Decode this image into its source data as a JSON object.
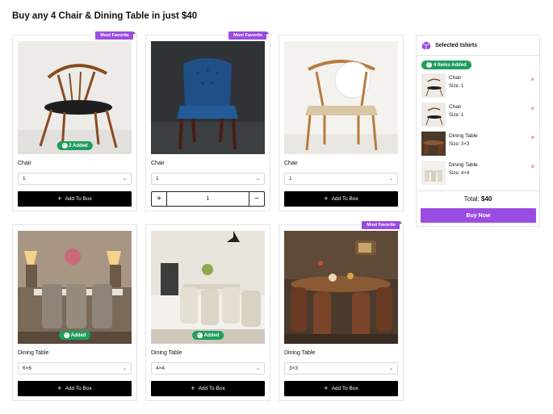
{
  "page": {
    "title": "Buy any 4 Chair & Dining Table in just $40"
  },
  "products": [
    {
      "ribbon": "Most Favorite",
      "badge": "2 Added",
      "name": "Chair",
      "option": "1",
      "button": "Add To Box"
    },
    {
      "ribbon": "Most Favorite",
      "name": "Chair",
      "option": "1",
      "quantity": "1"
    },
    {
      "name": "Chair",
      "option": "1",
      "button": "Add To Box"
    },
    {
      "badge": "Added",
      "name": "Dining Table",
      "option": "6×6",
      "button": "Add To Box"
    },
    {
      "badge": "Added",
      "name": "Dining Table",
      "option": "4×4",
      "button": "Add To Box"
    },
    {
      "ribbon": "Most Favorite",
      "name": "Dining Table",
      "option": "3×3",
      "button": "Add To Box"
    }
  ],
  "cart": {
    "title": "Selected tshirts",
    "badge": "4 Items Added",
    "items": [
      {
        "name": "Chair",
        "size": "Size: 1"
      },
      {
        "name": "Chair",
        "size": "Size: 1"
      },
      {
        "name": "Dining Table",
        "size": "Size: 3×3"
      },
      {
        "name": "Dining Table",
        "size": "Size: 4×4"
      }
    ],
    "total_label": "Total:",
    "total_value": "$40",
    "buy_label": "Buy Now"
  },
  "icons": {
    "remove": "×",
    "plus": "+",
    "minus": "−",
    "chevron": "⌄",
    "check": "✓"
  },
  "colors": {
    "accent": "#9b4ce0",
    "success": "#1e9e5c",
    "danger": "#e04848",
    "button": "#000000"
  }
}
